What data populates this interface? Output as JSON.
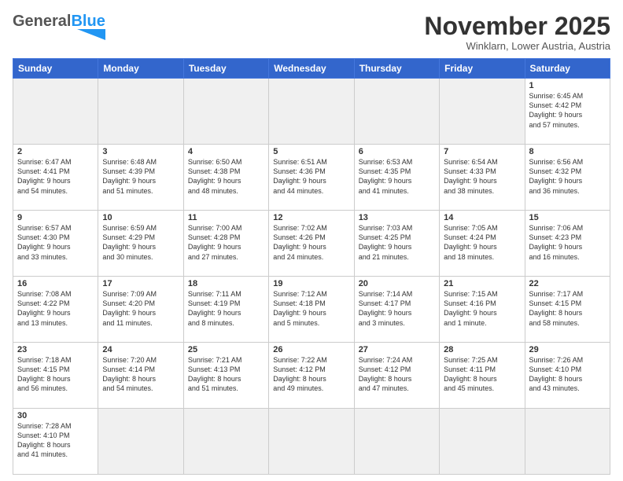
{
  "header": {
    "logo": {
      "general": "General",
      "blue": "Blue"
    },
    "title": "November 2025",
    "subtitle": "Winklarn, Lower Austria, Austria"
  },
  "weekdays": [
    "Sunday",
    "Monday",
    "Tuesday",
    "Wednesday",
    "Thursday",
    "Friday",
    "Saturday"
  ],
  "days": [
    {
      "date": "",
      "empty": true
    },
    {
      "date": "",
      "empty": true
    },
    {
      "date": "",
      "empty": true
    },
    {
      "date": "",
      "empty": true
    },
    {
      "date": "",
      "empty": true
    },
    {
      "date": "",
      "empty": true
    },
    {
      "date": "1",
      "sunrise": "6:45 AM",
      "sunset": "4:42 PM",
      "daylight_hours": "9 hours",
      "daylight_minutes": "and 57 minutes."
    },
    {
      "date": "2",
      "sunrise": "6:47 AM",
      "sunset": "4:41 PM",
      "daylight_hours": "9 hours",
      "daylight_minutes": "and 54 minutes."
    },
    {
      "date": "3",
      "sunrise": "6:48 AM",
      "sunset": "4:39 PM",
      "daylight_hours": "9 hours",
      "daylight_minutes": "and 51 minutes."
    },
    {
      "date": "4",
      "sunrise": "6:50 AM",
      "sunset": "4:38 PM",
      "daylight_hours": "9 hours",
      "daylight_minutes": "and 48 minutes."
    },
    {
      "date": "5",
      "sunrise": "6:51 AM",
      "sunset": "4:36 PM",
      "daylight_hours": "9 hours",
      "daylight_minutes": "and 44 minutes."
    },
    {
      "date": "6",
      "sunrise": "6:53 AM",
      "sunset": "4:35 PM",
      "daylight_hours": "9 hours",
      "daylight_minutes": "and 41 minutes."
    },
    {
      "date": "7",
      "sunrise": "6:54 AM",
      "sunset": "4:33 PM",
      "daylight_hours": "9 hours",
      "daylight_minutes": "and 38 minutes."
    },
    {
      "date": "8",
      "sunrise": "6:56 AM",
      "sunset": "4:32 PM",
      "daylight_hours": "9 hours",
      "daylight_minutes": "and 36 minutes."
    },
    {
      "date": "9",
      "sunrise": "6:57 AM",
      "sunset": "4:30 PM",
      "daylight_hours": "9 hours",
      "daylight_minutes": "and 33 minutes."
    },
    {
      "date": "10",
      "sunrise": "6:59 AM",
      "sunset": "4:29 PM",
      "daylight_hours": "9 hours",
      "daylight_minutes": "and 30 minutes."
    },
    {
      "date": "11",
      "sunrise": "7:00 AM",
      "sunset": "4:28 PM",
      "daylight_hours": "9 hours",
      "daylight_minutes": "and 27 minutes."
    },
    {
      "date": "12",
      "sunrise": "7:02 AM",
      "sunset": "4:26 PM",
      "daylight_hours": "9 hours",
      "daylight_minutes": "and 24 minutes."
    },
    {
      "date": "13",
      "sunrise": "7:03 AM",
      "sunset": "4:25 PM",
      "daylight_hours": "9 hours",
      "daylight_minutes": "and 21 minutes."
    },
    {
      "date": "14",
      "sunrise": "7:05 AM",
      "sunset": "4:24 PM",
      "daylight_hours": "9 hours",
      "daylight_minutes": "and 18 minutes."
    },
    {
      "date": "15",
      "sunrise": "7:06 AM",
      "sunset": "4:23 PM",
      "daylight_hours": "9 hours",
      "daylight_minutes": "and 16 minutes."
    },
    {
      "date": "16",
      "sunrise": "7:08 AM",
      "sunset": "4:22 PM",
      "daylight_hours": "9 hours",
      "daylight_minutes": "and 13 minutes."
    },
    {
      "date": "17",
      "sunrise": "7:09 AM",
      "sunset": "4:20 PM",
      "daylight_hours": "9 hours",
      "daylight_minutes": "and 11 minutes."
    },
    {
      "date": "18",
      "sunrise": "7:11 AM",
      "sunset": "4:19 PM",
      "daylight_hours": "9 hours",
      "daylight_minutes": "and 8 minutes."
    },
    {
      "date": "19",
      "sunrise": "7:12 AM",
      "sunset": "4:18 PM",
      "daylight_hours": "9 hours",
      "daylight_minutes": "and 5 minutes."
    },
    {
      "date": "20",
      "sunrise": "7:14 AM",
      "sunset": "4:17 PM",
      "daylight_hours": "9 hours",
      "daylight_minutes": "and 3 minutes."
    },
    {
      "date": "21",
      "sunrise": "7:15 AM",
      "sunset": "4:16 PM",
      "daylight_hours": "9 hours",
      "daylight_minutes": "and 1 minute."
    },
    {
      "date": "22",
      "sunrise": "7:17 AM",
      "sunset": "4:15 PM",
      "daylight_hours": "8 hours",
      "daylight_minutes": "and 58 minutes."
    },
    {
      "date": "23",
      "sunrise": "7:18 AM",
      "sunset": "4:15 PM",
      "daylight_hours": "8 hours",
      "daylight_minutes": "and 56 minutes."
    },
    {
      "date": "24",
      "sunrise": "7:20 AM",
      "sunset": "4:14 PM",
      "daylight_hours": "8 hours",
      "daylight_minutes": "and 54 minutes."
    },
    {
      "date": "25",
      "sunrise": "7:21 AM",
      "sunset": "4:13 PM",
      "daylight_hours": "8 hours",
      "daylight_minutes": "and 51 minutes."
    },
    {
      "date": "26",
      "sunrise": "7:22 AM",
      "sunset": "4:12 PM",
      "daylight_hours": "8 hours",
      "daylight_minutes": "and 49 minutes."
    },
    {
      "date": "27",
      "sunrise": "7:24 AM",
      "sunset": "4:12 PM",
      "daylight_hours": "8 hours",
      "daylight_minutes": "and 47 minutes."
    },
    {
      "date": "28",
      "sunrise": "7:25 AM",
      "sunset": "4:11 PM",
      "daylight_hours": "8 hours",
      "daylight_minutes": "and 45 minutes."
    },
    {
      "date": "29",
      "sunrise": "7:26 AM",
      "sunset": "4:10 PM",
      "daylight_hours": "8 hours",
      "daylight_minutes": "and 43 minutes."
    },
    {
      "date": "30",
      "sunrise": "7:28 AM",
      "sunset": "4:10 PM",
      "daylight_hours": "8 hours",
      "daylight_minutes": "and 41 minutes."
    }
  ]
}
